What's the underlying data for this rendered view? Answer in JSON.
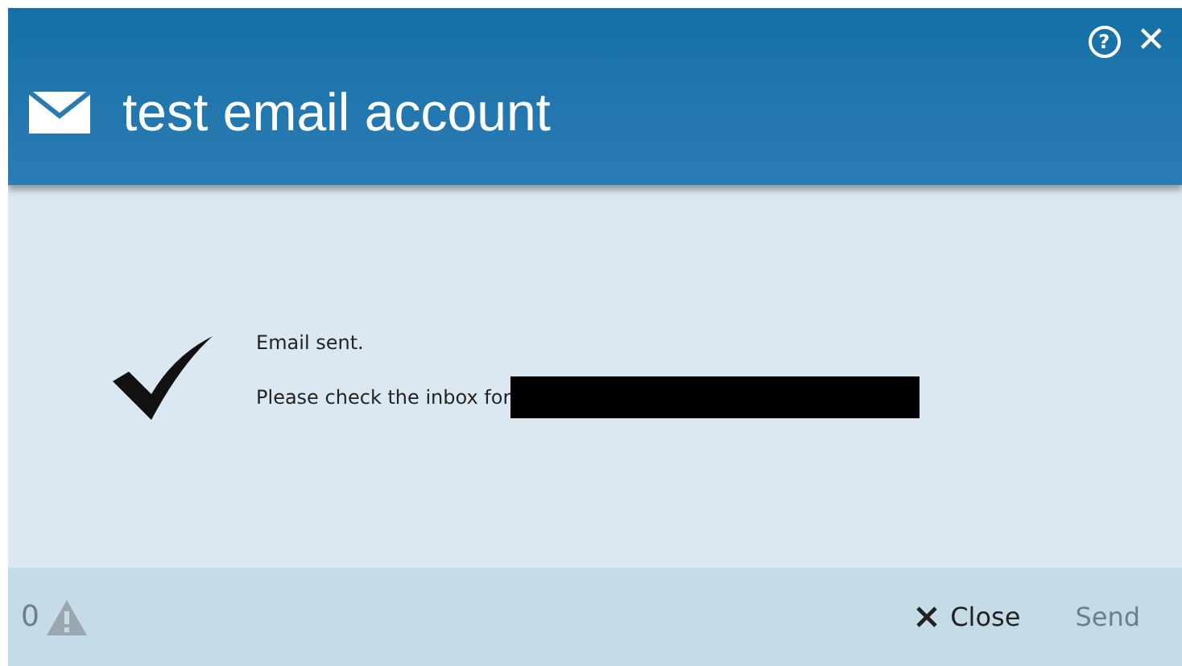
{
  "window": {
    "title": "test email account",
    "help": "?",
    "close": "✕"
  },
  "message": {
    "kind": "success",
    "lines": [
      {
        "text": "Email sent.",
        "redacted": false
      },
      {
        "text": "Please check the inbox for",
        "redacted": true
      }
    ]
  },
  "footer": {
    "warning_count": "0",
    "buttons": [
      {
        "label": "Close",
        "kind": "close",
        "disabled": false
      },
      {
        "label": "Send",
        "kind": "plain",
        "disabled": true
      }
    ]
  }
}
